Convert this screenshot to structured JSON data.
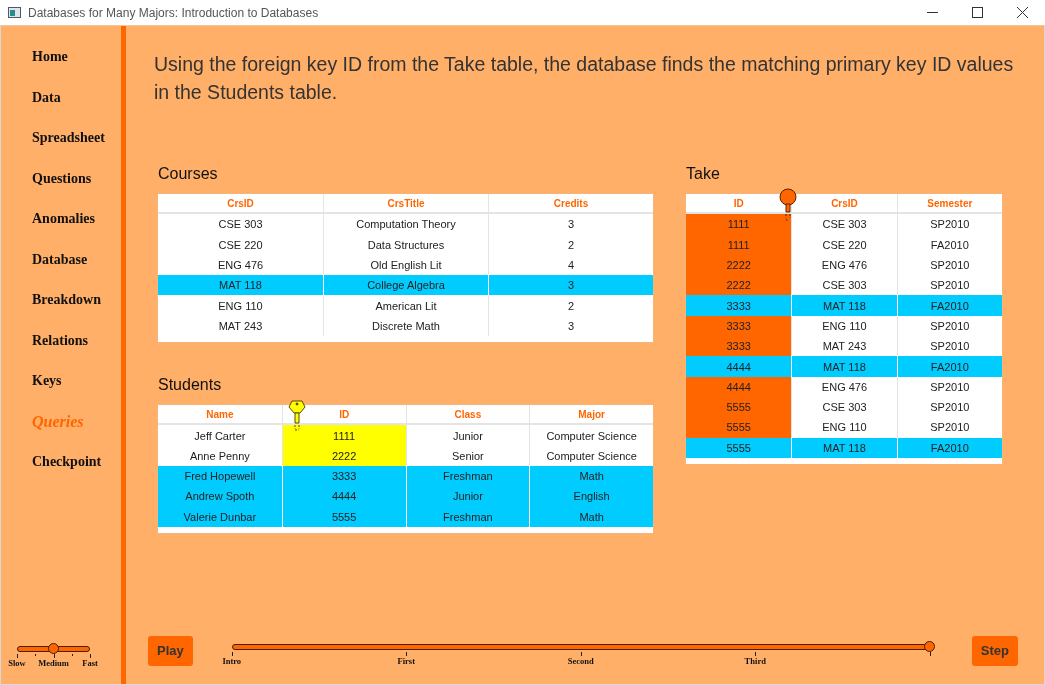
{
  "window": {
    "title": "Databases for Many Majors: Introduction to Databases"
  },
  "sidebar": {
    "items": [
      {
        "label": "Home",
        "selected": false
      },
      {
        "label": "Data",
        "selected": false
      },
      {
        "label": "Spreadsheet",
        "selected": false
      },
      {
        "label": "Questions",
        "selected": false
      },
      {
        "label": "Anomalies",
        "selected": false
      },
      {
        "label": "Database",
        "selected": false
      },
      {
        "label": "Breakdown",
        "selected": false
      },
      {
        "label": "Relations",
        "selected": false
      },
      {
        "label": "Keys",
        "selected": false
      },
      {
        "label": "Queries",
        "selected": true
      },
      {
        "label": "Checkpoint",
        "selected": false
      }
    ]
  },
  "instruction": "Using the foreign key ID from the Take table, the database finds the matching primary key ID values in the Students table.",
  "tables": [
    {
      "title": "Courses",
      "columns": [
        {
          "header": "CrsID",
          "kind": "plain"
        },
        {
          "header": "CrsTitle",
          "kind": "plain"
        },
        {
          "header": "Credits",
          "kind": "plain"
        }
      ],
      "rows": [
        {
          "cells": [
            "CSE 303",
            "Computation Theory",
            "3"
          ],
          "selected": false
        },
        {
          "cells": [
            "CSE 220",
            "Data Structures",
            "2"
          ],
          "selected": false
        },
        {
          "cells": [
            "ENG 476",
            "Old English Lit",
            "4"
          ],
          "selected": false
        },
        {
          "cells": [
            "MAT 118",
            "College Algebra",
            "3"
          ],
          "selected": true
        },
        {
          "cells": [
            "ENG 110",
            "American Lit",
            "2"
          ],
          "selected": false
        },
        {
          "cells": [
            "MAT 243",
            "Discrete Math",
            "3"
          ],
          "selected": false
        }
      ]
    },
    {
      "title": "Students",
      "columns": [
        {
          "header": "Name",
          "kind": "plain"
        },
        {
          "header": "ID",
          "kind": "primary_key",
          "color": "#ffff00"
        },
        {
          "header": "Class",
          "kind": "plain"
        },
        {
          "header": "Major",
          "kind": "plain"
        }
      ],
      "rows": [
        {
          "cells": [
            "Jeff Carter",
            "1111",
            "Junior",
            "Computer Science"
          ],
          "selected": false
        },
        {
          "cells": [
            "Anne Penny",
            "2222",
            "Senior",
            "Computer Science"
          ],
          "selected": false
        },
        {
          "cells": [
            "Fred Hopewell",
            "3333",
            "Freshman",
            "Math"
          ],
          "selected": true
        },
        {
          "cells": [
            "Andrew Spoth",
            "4444",
            "Junior",
            "English"
          ],
          "selected": true
        },
        {
          "cells": [
            "Valerie Dunbar",
            "5555",
            "Freshman",
            "Math"
          ],
          "selected": true
        }
      ]
    },
    {
      "title": "Take",
      "columns": [
        {
          "header": "ID",
          "kind": "foreign_key",
          "color": "#ff6600"
        },
        {
          "header": "CrsID",
          "kind": "plain"
        },
        {
          "header": "Semester",
          "kind": "plain"
        }
      ],
      "rows": [
        {
          "cells": [
            "1111",
            "CSE 303",
            "SP2010"
          ],
          "selected": false
        },
        {
          "cells": [
            "1111",
            "CSE 220",
            "FA2010"
          ],
          "selected": false
        },
        {
          "cells": [
            "2222",
            "ENG 476",
            "SP2010"
          ],
          "selected": false
        },
        {
          "cells": [
            "2222",
            "CSE 303",
            "SP2010"
          ],
          "selected": false
        },
        {
          "cells": [
            "3333",
            "MAT 118",
            "FA2010"
          ],
          "selected": true
        },
        {
          "cells": [
            "3333",
            "ENG 110",
            "SP2010"
          ],
          "selected": false
        },
        {
          "cells": [
            "3333",
            "MAT 243",
            "SP2010"
          ],
          "selected": false
        },
        {
          "cells": [
            "4444",
            "MAT 118",
            "FA2010"
          ],
          "selected": true
        },
        {
          "cells": [
            "4444",
            "ENG 476",
            "SP2010"
          ],
          "selected": false
        },
        {
          "cells": [
            "5555",
            "CSE 303",
            "SP2010"
          ],
          "selected": false
        },
        {
          "cells": [
            "5555",
            "ENG 110",
            "SP2010"
          ],
          "selected": false
        },
        {
          "cells": [
            "5555",
            "MAT 118",
            "FA2010"
          ],
          "selected": true
        }
      ]
    }
  ],
  "speed_slider": {
    "kind": "speed",
    "labels": [
      "Slow",
      "Medium",
      "Fast"
    ],
    "level": 0.5
  },
  "play_button": "Play",
  "timeline": {
    "kind": "timeline",
    "labels": [
      "Intro",
      "First",
      "Second",
      "Third"
    ],
    "level": 1
  },
  "step_button": "Step"
}
